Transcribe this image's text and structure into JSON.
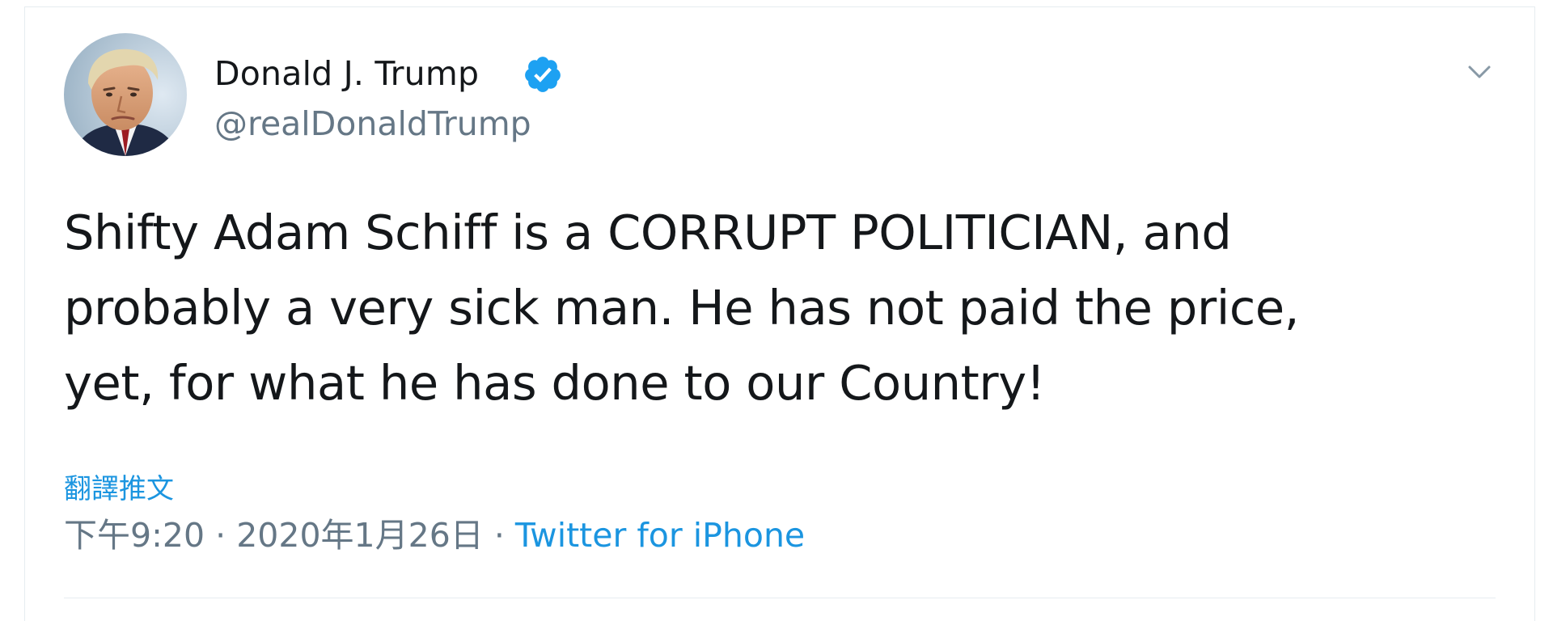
{
  "tweet": {
    "display_name": "Donald J. Trump",
    "handle": "@realDonaldTrump",
    "verified": true,
    "verified_icon": "verified-badge-icon",
    "caret_icon": "chevron-down-icon",
    "avatar_icon": "profile-photo",
    "text": "Shifty Adam Schiff is a CORRUPT POLITICIAN, and\nprobably a very sick man. He has not paid the price,\nyet, for what he has done to our Country!",
    "translate_label": "翻譯推文",
    "time": "下午9:20",
    "separator": " · ",
    "date": "2020年1月26日",
    "source": "Twitter for iPhone"
  },
  "colors": {
    "text_primary": "#14171a",
    "text_secondary": "#657786",
    "link": "#1b95e0",
    "verified": "#1da1f2",
    "divider": "#e6ecf0"
  }
}
